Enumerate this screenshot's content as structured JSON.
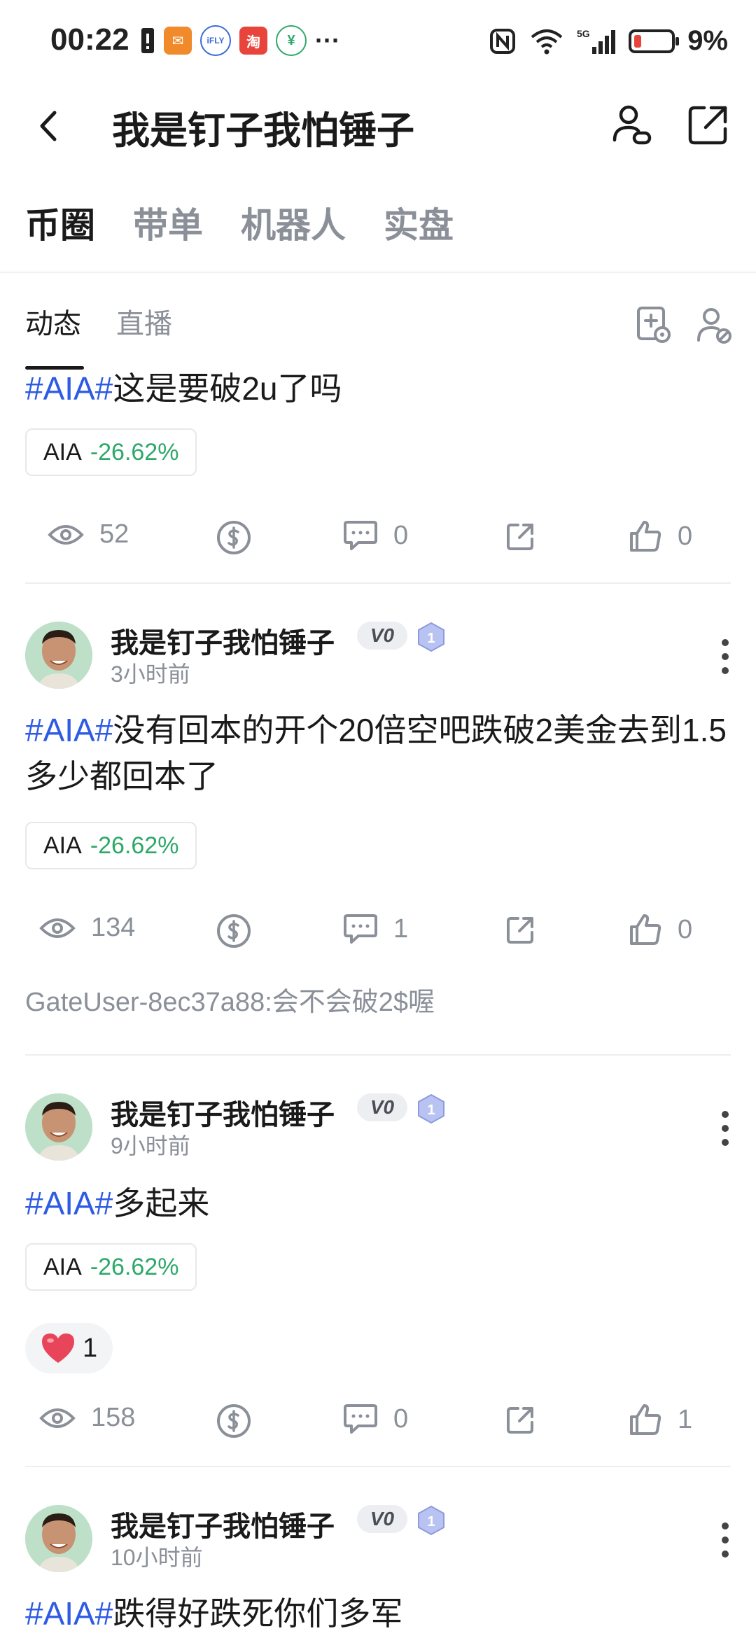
{
  "status_bar": {
    "time": "00:22",
    "battery": "9%",
    "network": "5G"
  },
  "header": {
    "title": "我是钉子我怕锤子"
  },
  "tabs": [
    "币圈",
    "带单",
    "机器人",
    "实盘"
  ],
  "subtabs": [
    "动态",
    "直播"
  ],
  "posts": [
    {
      "tag": "#AIA#",
      "text": "这是要破2u了吗",
      "coin": "AIA",
      "change": "-26.62%",
      "views": "52",
      "comments": "0",
      "likes": "0"
    },
    {
      "author": "我是钉子我怕锤子",
      "badge": "V0",
      "level": "1",
      "time": "3小时前",
      "tag": "#AIA#",
      "text": "没有回本的开个20倍空吧跌破2美金去到1.5多少都回本了",
      "coin": "AIA",
      "change": "-26.62%",
      "views": "134",
      "comments": "1",
      "likes": "0",
      "top_comment": "GateUser-8ec37a88:会不会破2$喔"
    },
    {
      "author": "我是钉子我怕锤子",
      "badge": "V0",
      "level": "1",
      "time": "9小时前",
      "tag": "#AIA#",
      "text": "多起来",
      "coin": "AIA",
      "change": "-26.62%",
      "reaction_count": "1",
      "views": "158",
      "comments": "0",
      "likes": "1"
    },
    {
      "author": "我是钉子我怕锤子",
      "badge": "V0",
      "level": "1",
      "time": "10小时前",
      "tag": "#AIA#",
      "text": "跌得好跌死你们多军"
    }
  ]
}
